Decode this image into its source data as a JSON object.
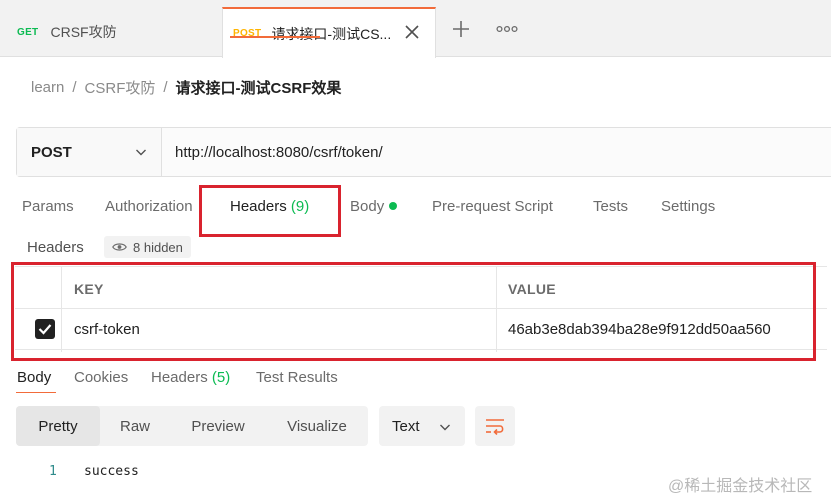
{
  "tabs": [
    {
      "method": "GET",
      "title": "CRSF攻防"
    },
    {
      "method": "POST",
      "title": "请求接口-测试CS..."
    }
  ],
  "icons": {
    "close": "close-icon",
    "new_tab": "plus-icon",
    "more": "more-icon",
    "eye": "eye-icon",
    "wrap": "wrap-lines-icon",
    "check": "check-icon",
    "chevron": "chevron-down-icon"
  },
  "colors": {
    "accent": "#f26b3a",
    "get_method": "#0cbb52",
    "post_method": "#ffb400",
    "highlight_box": "#d9232e"
  },
  "breadcrumb": {
    "items": [
      "learn",
      "CSRF攻防"
    ],
    "separator": "/",
    "current": "请求接口-测试CSRF效果"
  },
  "request": {
    "method": "POST",
    "url": "http://localhost:8080/csrf/token/"
  },
  "request_tabs": [
    {
      "label": "Params"
    },
    {
      "label": "Authorization"
    },
    {
      "label": "Headers",
      "count": "(9)"
    },
    {
      "label": "Body"
    },
    {
      "label": "Pre-request Script"
    },
    {
      "label": "Tests"
    },
    {
      "label": "Settings"
    }
  ],
  "headers_section": {
    "title": "Headers",
    "hidden_label": "8 hidden"
  },
  "headers_table": {
    "columns": [
      "KEY",
      "VALUE"
    ],
    "rows": [
      {
        "key": "csrf-token",
        "value": "46ab3e8dab394ba28e9f912dd50aa560",
        "enabled": true
      }
    ]
  },
  "response_tabs": [
    {
      "label": "Body"
    },
    {
      "label": "Cookies"
    },
    {
      "label": "Headers",
      "count": "(5)"
    },
    {
      "label": "Test Results"
    }
  ],
  "view_modes": [
    "Pretty",
    "Raw",
    "Preview",
    "Visualize"
  ],
  "format": "Text",
  "response_body": {
    "line_number": "1",
    "text": "success"
  },
  "watermark": "@稀土掘金技术社区"
}
